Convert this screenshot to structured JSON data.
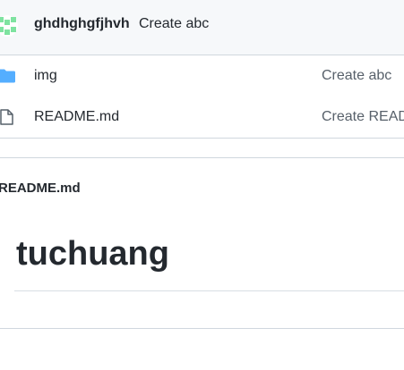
{
  "latest_commit": {
    "author": "ghdhghgfjhvh",
    "message": "Create abc"
  },
  "files": [
    {
      "name": "img",
      "type": "folder",
      "icon": "folder-icon",
      "commit_message": "Create abc"
    },
    {
      "name": "README.md",
      "type": "file",
      "icon": "file-icon",
      "commit_message": "Create READ"
    }
  ],
  "readme": {
    "header": "README.md",
    "heading": "tuchuang"
  },
  "colors": {
    "folder": "#54aeff",
    "avatar": "#7ee3a0",
    "border": "#d0d7de",
    "muted_text": "#57606a"
  }
}
